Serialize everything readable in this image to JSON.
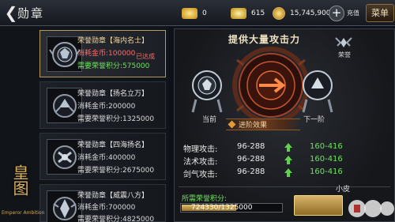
{
  "header": {
    "title": "勋章",
    "ingot_value": "0",
    "bound_ingot_value": "615",
    "gold_value": "15,745,900",
    "recharge_label": "充值",
    "menu_label": "菜单"
  },
  "medals": [
    {
      "name": "荣誉勋章【海内名士】",
      "cost": "消耗金币:100000",
      "honor": "需要荣誉积分:575000",
      "achieved": "已达成"
    },
    {
      "name": "荣誉勋章【扬名立万】",
      "cost": "消耗金币:200000",
      "honor": "需要荣誉积分:1325000"
    },
    {
      "name": "荣誉勋章【四海扬名】",
      "cost": "消耗金币:400000",
      "honor": "需要荣誉积分:2675000"
    },
    {
      "name": "荣誉勋章【威震八方】",
      "cost": "消耗金币:700000",
      "honor": "需要荣誉积分:4825000"
    }
  ],
  "logo": {
    "glyph": "皇图",
    "subtitle": "Emperor Ambition"
  },
  "panel": {
    "title": "提供大量攻击力",
    "honor_label": "荣誉",
    "prev_label": "当前",
    "next_label": "下一阶",
    "advance_label": "进阶效果"
  },
  "stats": [
    {
      "label": "物理攻击:",
      "current": "96-288",
      "next": "160-416"
    },
    {
      "label": "法术攻击:",
      "current": "96-288",
      "next": "160-416"
    },
    {
      "label": "剑气攻击:",
      "current": "96-288",
      "next": "160-416"
    }
  ],
  "requirement": {
    "label": "所需荣誉积分:",
    "progress_text": "724330/1325000",
    "progress_fraction": 0.5467
  },
  "watermark": {
    "text": "小皮"
  },
  "colors": {
    "accent_gold": "#d8b46a",
    "green": "#6fe25c",
    "red": "#ff6a6a"
  }
}
